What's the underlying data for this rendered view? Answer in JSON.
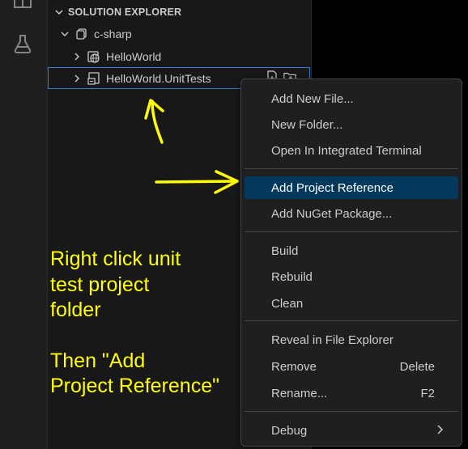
{
  "sidebar": {
    "section_title": "SOLUTION EXPLORER",
    "tree": [
      {
        "label": "c-sharp",
        "icon": "solution-icon"
      },
      {
        "label": "HelloWorld",
        "icon": "web-project-icon"
      },
      {
        "label": "HelloWorld.UnitTests",
        "icon": "test-project-icon",
        "selected": true
      }
    ]
  },
  "context_menu": {
    "items": [
      {
        "label": "Add New File..."
      },
      {
        "label": "New Folder..."
      },
      {
        "label": "Open In Integrated Terminal"
      },
      {
        "label": "Add Project Reference",
        "active": true
      },
      {
        "label": "Add NuGet Package..."
      },
      {
        "label": "Build"
      },
      {
        "label": "Rebuild"
      },
      {
        "label": "Clean"
      },
      {
        "label": "Reveal in File Explorer"
      },
      {
        "label": "Remove",
        "shortcut": "Delete"
      },
      {
        "label": "Rename...",
        "shortcut": "F2"
      },
      {
        "label": "Debug",
        "has_submenu": true
      }
    ]
  },
  "annotation": {
    "line1": "Right click unit",
    "line2": "test project",
    "line3": "folder",
    "line4": "Then \"Add",
    "line5": "Project Reference\"",
    "color": "#ffff00"
  },
  "colors": {
    "accent_selection": "#04395e",
    "focus_border": "#3a7ac9",
    "annotation": "#ffff00"
  }
}
